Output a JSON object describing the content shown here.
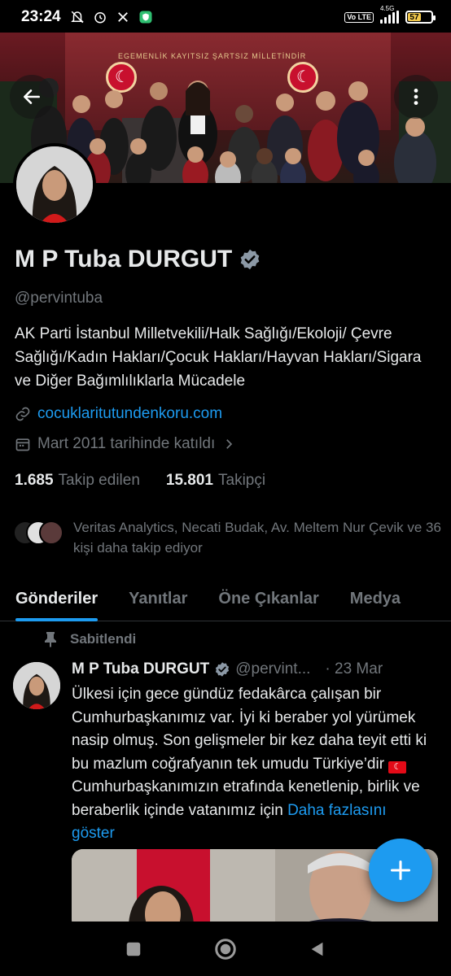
{
  "status_bar": {
    "time": "23:24",
    "network": "4.5G",
    "volte": "Vo LTE",
    "battery": "57",
    "icons": [
      "mute-icon",
      "alarm-icon",
      "x-app-icon",
      "shield-app-icon"
    ]
  },
  "banner": {
    "motto": "EGEMENLİK KAYITSIZ ŞARTSIZ MİLLETİNDİR"
  },
  "profile": {
    "display_name": "M P Tuba DURGUT",
    "handle": "@pervintuba",
    "bio": "AK Parti İstanbul Milletvekili/Halk Sağlığı/Ekoloji/ Çevre Sağlığı/Kadın Hakları/Çocuk Hakları/Hayvan Hakları/Sigara ve Diğer Bağımlılıklarla Mücadele",
    "website": "cocuklaritutundenkoru.com",
    "joined": "Mart 2011 tarihinde katıldı",
    "following_count": "1.685",
    "following_label": "Takip edilen",
    "followers_count": "15.801",
    "followers_label": "Takipçi",
    "followed_by": "Veritas Analytics, Necati Budak, Av. Meltem Nur Çevik ve 36 kişi daha takip ediyor"
  },
  "tabs": [
    {
      "label": "Gönderiler",
      "active": true
    },
    {
      "label": "Yanıtlar",
      "active": false
    },
    {
      "label": "Öne Çıkanlar",
      "active": false
    },
    {
      "label": "Medya",
      "active": false
    }
  ],
  "pinned_post": {
    "pinned_label": "Sabitlendi",
    "author": "M P Tuba DURGUT",
    "handle": "@pervint...",
    "date": "· 23 Mar",
    "text_part1": "Ülkesi için gece gündüz fedakârca çalışan bir Cumhurbaşkanımız var. İyi ki beraber yol yürümek nasip olmuş. Son gelişmeler bir kez daha teyit etti ki bu mazlum coğrafyanın tek umudu Türkiye’dir ",
    "text_part2": "Cumhurbaşkanımızın etrafında kenetlenip, birlik ve beraberlik içinde vatanımız için ",
    "show_more": "Daha fazlasını göster"
  },
  "colors": {
    "accent": "#1d9bf0",
    "background": "#000000",
    "primary_text": "#e7e9ea",
    "secondary_text": "#71767b"
  }
}
